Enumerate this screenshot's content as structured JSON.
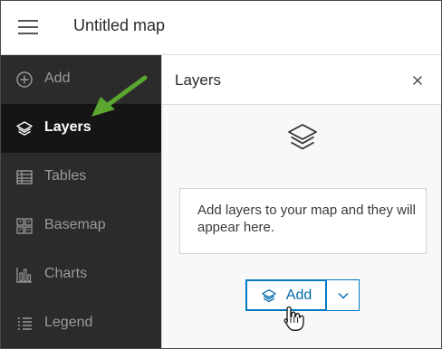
{
  "header": {
    "menu_icon": "hamburger-menu-icon",
    "title": "Untitled map"
  },
  "sidebar": {
    "items": [
      {
        "label": "Add",
        "icon": "plus-circle-icon",
        "active": false
      },
      {
        "label": "Layers",
        "icon": "layers-icon",
        "active": true
      },
      {
        "label": "Tables",
        "icon": "table-icon",
        "active": false
      },
      {
        "label": "Basemap",
        "icon": "basemap-icon",
        "active": false
      },
      {
        "label": "Charts",
        "icon": "bar-chart-icon",
        "active": false
      },
      {
        "label": "Legend",
        "icon": "legend-icon",
        "active": false
      }
    ]
  },
  "panel": {
    "title": "Layers",
    "close_icon": "close-icon",
    "empty_icon": "layers-icon",
    "empty_message": "Add layers to your map and they will appear here.",
    "add_button_label": "Add",
    "add_button_icon": "layers-add-icon",
    "dropdown_icon": "chevron-down-icon"
  },
  "colors": {
    "sidebar_bg": "#2b2b2b",
    "sidebar_active_bg": "#151515",
    "accent_blue": "#007ac2",
    "annotation_arrow": "#5aa630"
  }
}
